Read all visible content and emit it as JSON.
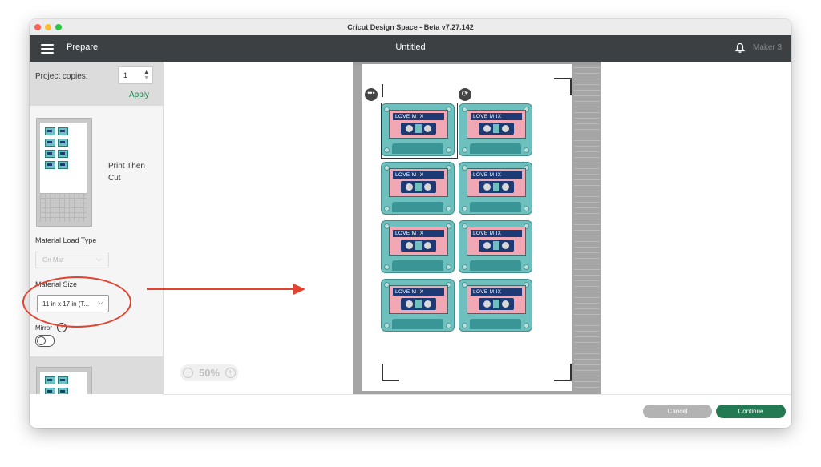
{
  "window": {
    "title": "Cricut Design Space - Beta v7.27.142"
  },
  "header": {
    "menu_label": "Prepare",
    "project_title": "Untitled",
    "machine": "Maker 3"
  },
  "left_panel": {
    "copies_label": "Project copies:",
    "copies_value": "1",
    "apply_label": "Apply",
    "mode_label": "Print Then\nCut",
    "material_load_type_label": "Material Load Type",
    "material_load_type_value": "On Mat",
    "material_size_label": "Material Size",
    "material_size_value": "11 in x 17 in (T...",
    "mirror_label": "Mirror",
    "info_glyph": "i"
  },
  "canvas": {
    "zoom": "50%",
    "zoom_minus": "−",
    "zoom_plus": "+",
    "cassette_text": "LOVE M IX",
    "more_glyph": "•••",
    "rotate_glyph": "⟳"
  },
  "footer": {
    "cancel_label": "Cancel",
    "continue_label": "Continue"
  },
  "colors": {
    "accent_green": "#237a52",
    "header": "#3c4043",
    "annotation_red": "#e2432f",
    "cassette_teal": "#6dc0bd",
    "label_pink": "#f2a8b4",
    "label_navy": "#1e3a75"
  }
}
